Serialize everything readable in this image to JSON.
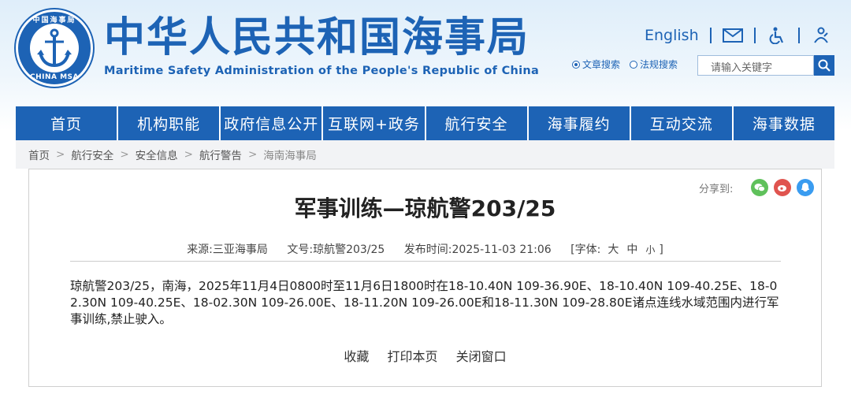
{
  "header": {
    "logo_top_text": "中国海事局",
    "logo_bottom_text": "CHINA MSA",
    "site_title": "中华人民共和国海事局",
    "site_subtitle": "Maritime Safety Administration of the People's Republic of China",
    "lang_link": "English",
    "icons": [
      "mail-icon",
      "accessibility-icon",
      "elder-care-icon"
    ],
    "search_options": [
      "文章搜索",
      "法规搜索"
    ],
    "search_placeholder": "请输入关键字"
  },
  "nav": {
    "items": [
      "首页",
      "机构职能",
      "政府信息公开",
      "互联网+政务",
      "航行安全",
      "海事履约",
      "互动交流",
      "海事数据"
    ]
  },
  "breadcrumb": {
    "items": [
      "首页",
      "航行安全",
      "安全信息",
      "航行警告"
    ],
    "current": "海南海事局"
  },
  "article": {
    "share_label": "分享到:",
    "share_icons": [
      "wechat-icon",
      "weibo-icon",
      "qq-icon"
    ],
    "title": "军事训练—琼航警203/25",
    "source_label": "来源:",
    "source": "三亚海事局",
    "doc_no_label": "文号:",
    "doc_no": "琼航警203/25",
    "date_label": "发布时间:",
    "date": "2025-11-03 21:06",
    "font_label": "[字体:",
    "font_large": "大",
    "font_medium": "中",
    "font_small": "小",
    "font_close": "]",
    "body": "琼航警203/25，南海，2025年11月4日0800时至11月6日1800时在18-10.40N 109-36.90E、18-10.40N 109-40.25E、18-02.30N 109-40.25E、18-02.30N 109-26.00E、18-11.20N 109-26.00E和18-11.30N 109-28.80E诸点连线水域范围内进行军事训练,禁止驶入。",
    "actions": [
      "收藏",
      "打印本页",
      "关闭窗口"
    ]
  },
  "colors": {
    "brand_blue": "#1d63b5",
    "wechat_green": "#5fc15b",
    "weibo_red": "#e0544f",
    "qq_blue": "#3a9cf0"
  }
}
